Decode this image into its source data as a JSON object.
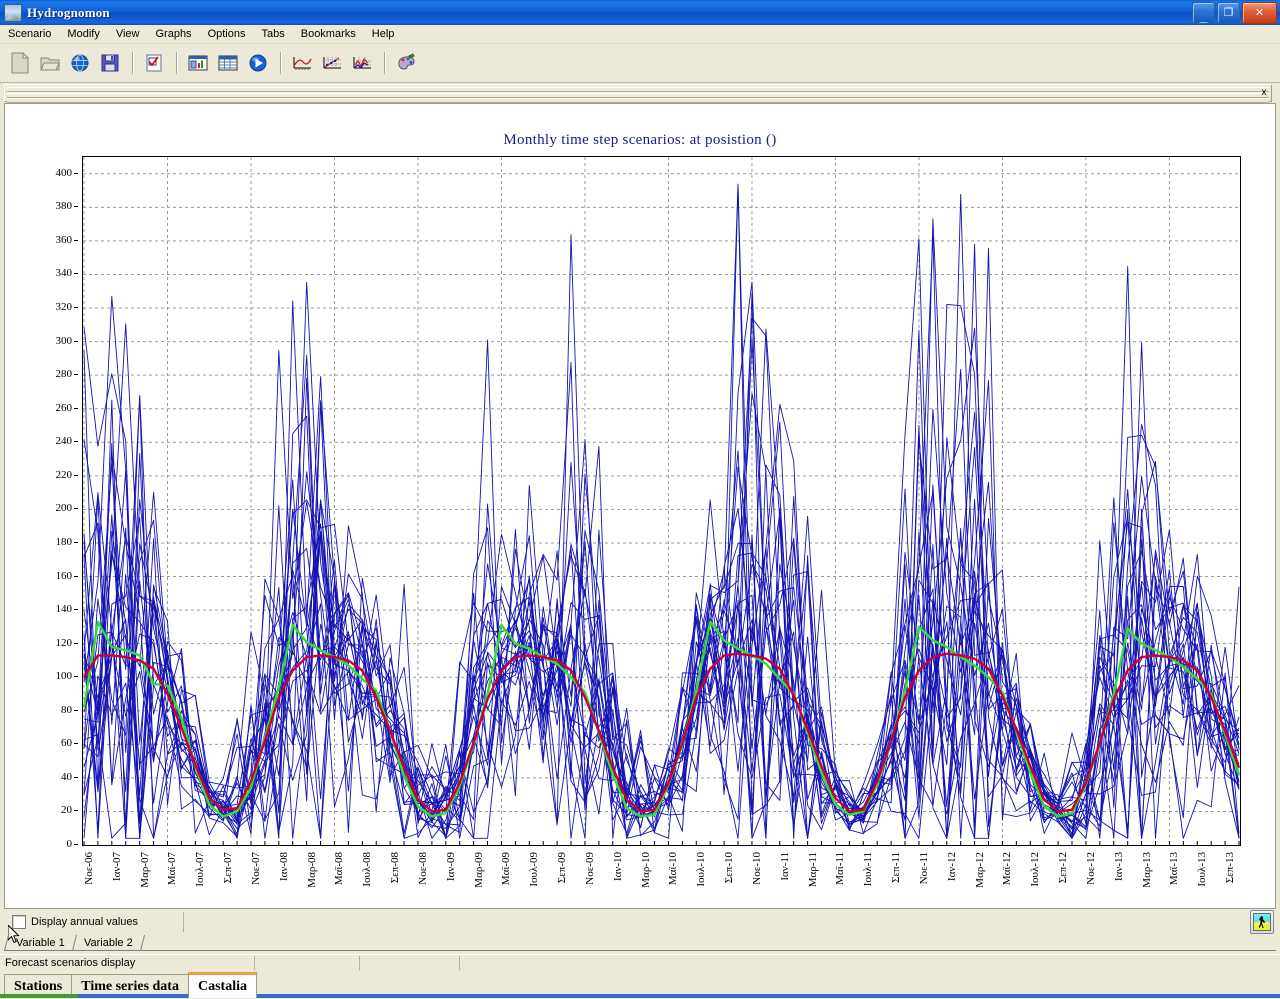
{
  "window": {
    "title": "Hydrognomon",
    "icon": "app-mountain-icon",
    "buttons": {
      "minimize": "_",
      "restore": "❐",
      "close": "✕"
    }
  },
  "menu": {
    "items": [
      {
        "label": "Scenario"
      },
      {
        "label": "Modify"
      },
      {
        "label": "View"
      },
      {
        "label": "Graphs"
      },
      {
        "label": "Options"
      },
      {
        "label": "Tabs"
      },
      {
        "label": "Bookmarks"
      },
      {
        "label": "Help"
      }
    ]
  },
  "toolbar": {
    "items": [
      {
        "name": "new-file-icon",
        "sep_after": false
      },
      {
        "name": "open-folder-icon",
        "sep_after": false
      },
      {
        "name": "globe-icon",
        "sep_after": false
      },
      {
        "name": "save-floppy-icon",
        "sep_after": true
      },
      {
        "name": "checklist-icon",
        "sep_after": true
      },
      {
        "name": "report-window-icon",
        "sep_after": false
      },
      {
        "name": "table-grid-icon",
        "sep_after": false
      },
      {
        "name": "play-run-icon",
        "sep_after": true
      },
      {
        "name": "chart-area-icon",
        "sep_after": false
      },
      {
        "name": "chart-scatter-icon",
        "sep_after": false
      },
      {
        "name": "chart-line-icon",
        "sep_after": true
      },
      {
        "name": "paint-palette-icon",
        "sep_after": false
      }
    ]
  },
  "inner_bar": {
    "close_glyph": "x"
  },
  "controls": {
    "display_annual_values_label": "Display annual values",
    "display_annual_values_checked": false,
    "run_button": "run-person-icon"
  },
  "variable_tabs": {
    "items": [
      {
        "label": "Variable 1",
        "active": true
      },
      {
        "label": "Variable 2",
        "active": false
      }
    ]
  },
  "statusbar": {
    "panels": [
      "Forecast scenarios display",
      "",
      "",
      ""
    ]
  },
  "page_tabs": {
    "items": [
      {
        "label": "Stations",
        "active": false
      },
      {
        "label": "Time series data",
        "active": false
      },
      {
        "label": "Castalia",
        "active": true
      }
    ]
  },
  "chart_data": {
    "type": "line",
    "title": "Monthly time step scenarios:  at posistion  ()",
    "xlabel": "",
    "ylabel": "",
    "ylim": [
      0,
      410
    ],
    "yticks": [
      0,
      20,
      40,
      60,
      80,
      100,
      120,
      140,
      160,
      180,
      200,
      220,
      240,
      260,
      280,
      300,
      320,
      340,
      360,
      380,
      400
    ],
    "grid": true,
    "legend_position": "none",
    "colors": {
      "scenarios": "#1414b4",
      "mean": "#cc0033",
      "reference": "#33dd33",
      "grid": "#9a9a9a",
      "axis": "#000000",
      "title": "#1a1a8c"
    },
    "x_tick_labels": [
      "Νοε-06",
      "Ιαν-07",
      "Μαρ-07",
      "Μαϊ-07",
      "Ιουλ-07",
      "Σεπ-07",
      "Νοε-07",
      "Ιαν-08",
      "Μαρ-08",
      "Μαϊ-08",
      "Ιουλ-08",
      "Σεπ-08",
      "Νοε-08",
      "Ιαν-09",
      "Μαρ-09",
      "Μαϊ-09",
      "Ιουλ-09",
      "Σεπ-09",
      "Νοε-09",
      "Ιαν-10",
      "Μαρ-10",
      "Μαϊ-10",
      "Ιουλ-10",
      "Σεπ-10",
      "Νοε-10",
      "Ιαν-11",
      "Μαρ-11",
      "Μαϊ-11",
      "Ιουλ-11",
      "Σεπ-11",
      "Νοε-11",
      "Ιαν-12",
      "Μαρ-12",
      "Μαϊ-12",
      "Ιουλ-12",
      "Σεπ-12",
      "Νοε-12",
      "Ιαν-13",
      "Μαρ-13",
      "Μαϊ-13",
      "Ιουλ-13",
      "Σεπ-13"
    ],
    "x_start": "Νοε-06",
    "x_end": "Σεπ-13",
    "n_months": 84,
    "n_scenario_series": 26,
    "series": [
      {
        "name": "mean",
        "color": "#cc0033",
        "values": [
          100,
          113,
          113,
          112,
          110,
          105,
          90,
          70,
          48,
          28,
          21,
          22,
          38,
          62,
          88,
          104,
          112,
          113,
          112,
          110,
          104,
          88,
          68,
          46,
          27,
          20,
          21,
          37,
          61,
          87,
          104,
          112,
          113,
          112,
          110,
          104,
          88,
          68,
          46,
          27,
          20,
          21,
          37,
          61,
          88,
          105,
          113,
          114,
          113,
          111,
          105,
          89,
          69,
          47,
          28,
          20,
          21,
          38,
          62,
          88,
          104,
          112,
          114,
          113,
          111,
          105,
          89,
          69,
          47,
          27,
          20,
          21,
          37,
          61,
          87,
          104,
          112,
          113,
          112,
          110,
          104,
          88,
          68,
          46
        ]
      },
      {
        "name": "reference",
        "color": "#33dd33",
        "values": [
          82,
          133,
          118,
          116,
          113,
          96,
          95,
          76,
          47,
          24,
          17,
          20,
          34,
          64,
          94,
          131,
          121,
          116,
          112,
          107,
          99,
          92,
          68,
          41,
          23,
          17,
          19,
          35,
          60,
          90,
          131,
          120,
          117,
          112,
          108,
          100,
          91,
          67,
          42,
          22,
          17,
          18,
          36,
          60,
          92,
          133,
          122,
          117,
          113,
          108,
          99,
          90,
          67,
          43,
          24,
          18,
          20,
          36,
          62,
          92,
          130,
          122,
          118,
          112,
          107,
          100,
          91,
          68,
          43,
          23,
          17,
          19,
          36,
          61,
          90,
          129,
          120,
          116,
          112,
          106,
          99,
          90,
          66,
          42
        ]
      }
    ],
    "scenario_envelope": {
      "min": 5,
      "max": 405,
      "description": "26 blue Monte-Carlo synthetic monthly scenarios"
    }
  }
}
